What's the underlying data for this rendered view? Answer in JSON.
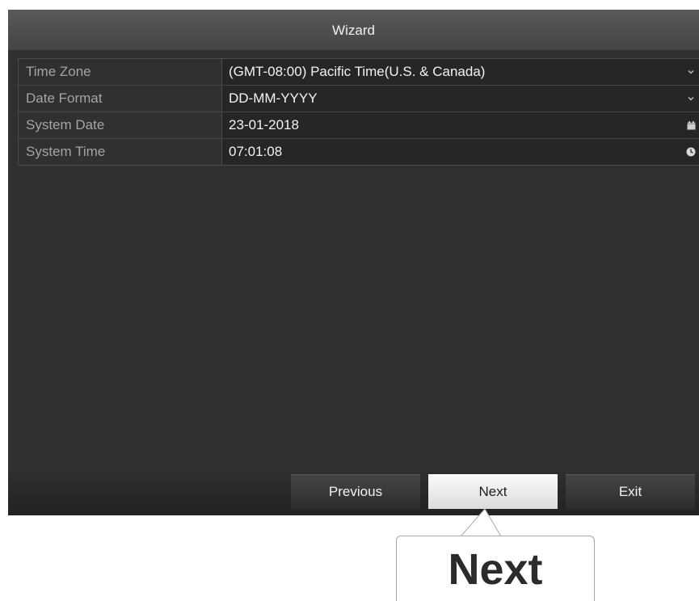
{
  "window": {
    "title": "Wizard"
  },
  "form": {
    "rows": [
      {
        "label": "Time Zone",
        "value": "(GMT-08:00) Pacific Time(U.S. & Canada)",
        "control": "dropdown-chevron-icon"
      },
      {
        "label": "Date Format",
        "value": "DD-MM-YYYY",
        "control": "dropdown-chevron-icon"
      },
      {
        "label": "System Date",
        "value": "23-01-2018",
        "control": "calendar-icon"
      },
      {
        "label": "System Time",
        "value": "07:01:08",
        "control": "clock-icon"
      }
    ]
  },
  "buttons": {
    "previous": "Previous",
    "next": "Next",
    "exit": "Exit"
  },
  "callout": {
    "text": "Next"
  },
  "colors": {
    "window_bg": "#303030",
    "field_bg": "#262626",
    "highlight_button": "#f0f0f0"
  }
}
